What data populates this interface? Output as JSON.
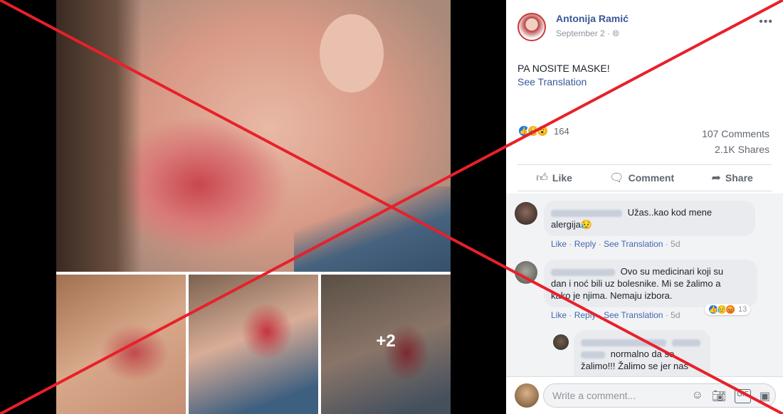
{
  "post": {
    "author": "Antonija Ramić",
    "date": "September 2",
    "text": "PA NOSITE MASKE!",
    "see_translation": "See Translation",
    "more_photos": "+2",
    "reactions_count": "164",
    "comments_count": "107 Comments",
    "shares_count": "2.1K Shares"
  },
  "actions": {
    "like": "Like",
    "comment": "Comment",
    "share": "Share"
  },
  "comments": [
    {
      "text_line1": "Užas..kao kod mene",
      "text_line2": "alergija😥",
      "like": "Like",
      "reply": "Reply",
      "see_translation": "See Translation",
      "time": "5d"
    },
    {
      "text_line1": "Ovo su medicinari koji su",
      "text_line2": "dan i noć bili uz bolesnike. Mi se žalimo a",
      "text_line3": "kako je njima. Nemaju izbora.",
      "like": "Like",
      "reply": "Reply",
      "see_translation": "See Translation",
      "time": "5d",
      "reaction_count": "13"
    },
    {
      "text_line1": "normalno da se",
      "text_line2": "žalimo!!! Žalimo se jer nas"
    }
  ],
  "composer": {
    "placeholder": "Write a comment..."
  },
  "colors": {
    "link": "#385898",
    "cross": "#e8202a"
  },
  "icons": [
    "globe-icon",
    "like-icon",
    "comment-icon",
    "share-icon",
    "emoji-icon",
    "camera-icon",
    "gif-icon",
    "sticker-icon"
  ]
}
